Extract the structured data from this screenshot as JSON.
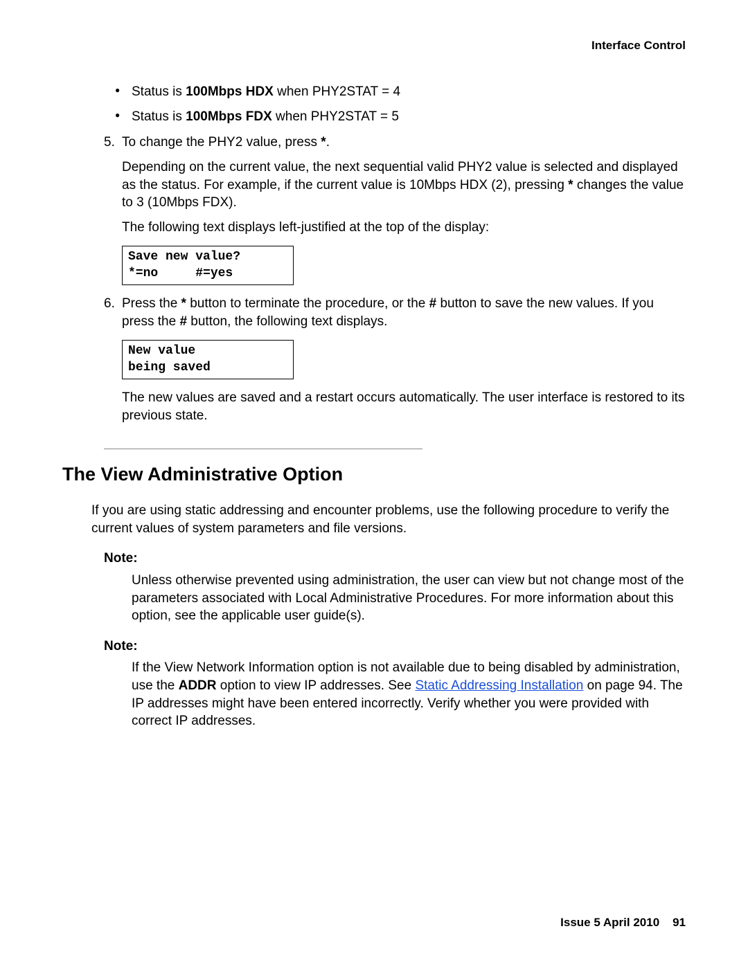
{
  "running_head": "Interface Control",
  "bullets": [
    {
      "prefix": "Status is ",
      "bold": "100Mbps HDX",
      "suffix": " when PHY2STAT = 4"
    },
    {
      "prefix": "Status is ",
      "bold": "100Mbps FDX",
      "suffix": " when PHY2STAT = 5"
    }
  ],
  "step5": {
    "num": "5.",
    "line1_a": "To change the PHY2 value, press ",
    "line1_b": "*",
    "line1_c": ".",
    "para2_a": "Depending on the current value, the next sequential valid PHY2 value is selected and displayed as the status. For example, if the current value is 10Mbps HDX (2), pressing ",
    "para2_b": "*",
    "para2_c": " changes the value to 3 (10Mbps FDX).",
    "para3": "The following text displays left-justified at the top of the display:",
    "code": "Save new value?\n*=no     #=yes"
  },
  "step6": {
    "num": "6.",
    "line1_a": "Press the ",
    "line1_b": "*",
    "line1_c": " button to terminate the procedure, or the ",
    "line1_d": "#",
    "line1_e": " button to save the new values. If you press the ",
    "line1_f": "#",
    "line1_g": " button, the following text displays.",
    "code": "New value\nbeing saved",
    "para2": "The new values are saved and a restart occurs automatically. The user interface is restored to its previous state."
  },
  "section_title": "The View Administrative Option",
  "section_intro": "If you are using static addressing and encounter problems, use the following procedure to verify the current values of system parameters and file versions.",
  "note1": {
    "label": "Note:",
    "body": "Unless otherwise prevented using administration, the user can view but not change most of the parameters associated with Local Administrative Procedures. For more information about this option, see the applicable user guide(s)."
  },
  "note2": {
    "label": "Note:",
    "body_a": "If the View Network Information option is not available due to being disabled by administration, use the ",
    "body_bold": "ADDR",
    "body_b": " option to view IP addresses. See ",
    "link": " Static Addressing Installation",
    "body_c": " on page 94. The IP addresses might have been entered incorrectly. Verify whether you were provided with correct IP addresses."
  },
  "footer": {
    "issue": "Issue 5   April 2010",
    "page": "91"
  }
}
